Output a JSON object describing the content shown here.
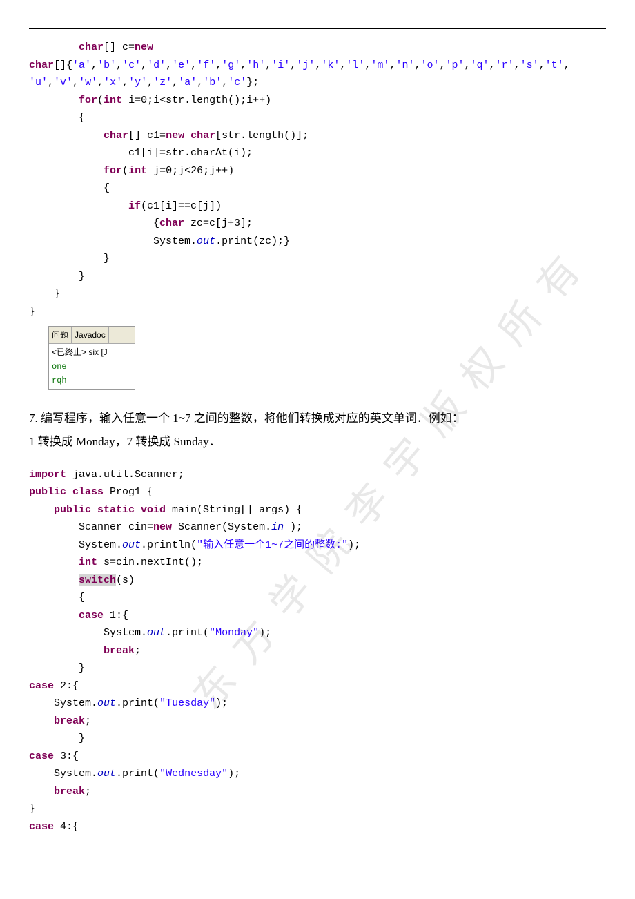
{
  "code1": {
    "l1a": "        ",
    "kw1": "char",
    "l1b": "[] c=",
    "kw2": "new",
    "l2a": "char",
    "l2b": "[]{",
    "l2c": "'a'",
    "l2d": ",",
    "l2e": "'b'",
    "l2f": ",",
    "l2g": "'c'",
    "l2h": ",",
    "l2i": "'d'",
    "l2j": ",",
    "l2k": "'e'",
    "l2l": ",",
    "l2m": "'f'",
    "l2n": ",",
    "l2o": "'g'",
    "l2p": ",",
    "l2q": "'h'",
    "l2r": ",",
    "l2s": "'i'",
    "l2t": ",",
    "l2u": "'j'",
    "l2v": ",",
    "l2w": "'k'",
    "l2x": ",",
    "l2y": "'l'",
    "l2z": ",",
    "l2aa": "'m'",
    "l2ab": ",",
    "l2ac": "'n'",
    "l2ad": ",",
    "l2ae": "'o'",
    "l2af": ",",
    "l2ag": "'p'",
    "l2ah": ",",
    "l2ai": "'q'",
    "l2aj": ",",
    "l2ak": "'r'",
    "l2al": ",",
    "l2am": "'s'",
    "l2an": ",",
    "l2ao": "'t'",
    "l2ap": ",",
    "l3a": "'u'",
    "l3b": ",",
    "l3c": "'v'",
    "l3d": ",",
    "l3e": "'w'",
    "l3f": ",",
    "l3g": "'x'",
    "l3h": ",",
    "l3i": "'y'",
    "l3j": ",",
    "l3k": "'z'",
    "l3l": ",",
    "l3m": "'a'",
    "l3n": ",",
    "l3o": "'b'",
    "l3p": ",",
    "l3q": "'c'",
    "l3r": "};",
    "l4a": "        ",
    "kw3": "for",
    "l4b": "(",
    "kw4": "int",
    "l4c": " i=0;i<str.length();i++)",
    "l5": "        {",
    "l6a": "            ",
    "kw5": "char",
    "l6b": "[] c1=",
    "kw6": "new char",
    "l6c": "[str.length()];",
    "l7": "                c1[i]=str.charAt(i);",
    "l8a": "            ",
    "kw7": "for",
    "l8b": "(",
    "kw8": "int",
    "l8c": " j=0;j<26;j++)",
    "l9": "            {",
    "l10a": "                ",
    "kw9": "if",
    "l10b": "(c1[i]==c[j])",
    "l11a": "                    {",
    "kw10": "char",
    "l11b": " zc=c[j+3];",
    "l12a": "                    System.",
    "st1": "out",
    "l12b": ".print(zc);}",
    "l13": "            }",
    "l14": "        }",
    "l15": "    }",
    "l16": "}"
  },
  "output": {
    "tab1": "问题",
    "tab2": "Javadoc",
    "status": "<已终止> six [J",
    "line1": "one",
    "line2": "rqh"
  },
  "prose": {
    "text": "7. 编写程序，输入任意一个 1~7 之间的整数，将他们转换成对应的英文单词．例如：",
    "text2": "1 转换成 Monday，7 转换成 Sunday．"
  },
  "code2": {
    "l1a": "import",
    "l1b": " java.util.Scanner;",
    "l2a": "public class",
    "l2b": " Prog1 {",
    "l3a": "    ",
    "kw1": "public static void",
    "l3b": " main(String[] args) {",
    "l4a": "        Scanner cin=",
    "kw2": "new",
    "l4b": " Scanner(System.",
    "st1": "in",
    "l4c": " );",
    "l5a": "        System.",
    "st2": "out",
    "l5b": ".println(",
    "str1": "\"输入任意一个1~7之间的整数:\"",
    "l5c": ");",
    "l6a": "        ",
    "kw3": "int",
    "l6b": " s=cin.nextInt();",
    "l7a": "        ",
    "kw4": "switch",
    "l7b": "(s)",
    "l8": "        {",
    "l9a": "        ",
    "kw5": "case",
    "l9b": " 1:{",
    "l10a": "            System.",
    "st3": "out",
    "l10b": ".print(",
    "str2": "\"Monday\"",
    "l10c": ");",
    "l11a": "            ",
    "kw6": "break",
    "l11b": ";",
    "l12": "        }",
    "l13a": "case",
    "l13b": " 2:{",
    "l14a": "    System.",
    "st4": "out",
    "l14b": ".print(",
    "str3": "\"Tuesday\"",
    "l14c": ");",
    "l15a": "    ",
    "kw7": "break",
    "l15b": ";",
    "l16": "        }",
    "l17a": "case",
    "l17b": " 3:{",
    "l18a": "    System.",
    "st5": "out",
    "l18b": ".print(",
    "str4": "\"Wednesday\"",
    "l18c": ");",
    "l19a": "    ",
    "kw8": "break",
    "l19b": ";",
    "l20": "}",
    "l21a": "case",
    "l21b": " 4:{"
  },
  "watermark": "东方学院李宇版权所有"
}
